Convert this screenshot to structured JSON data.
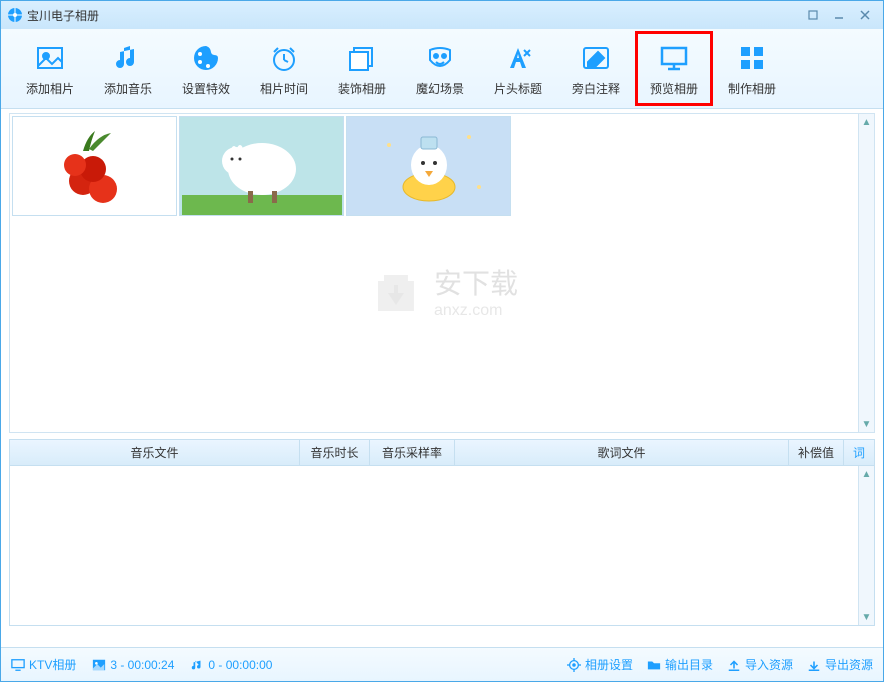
{
  "title": "宝川电子相册",
  "toolbar": [
    {
      "label": "添加相片",
      "icon": "image-icon"
    },
    {
      "label": "添加音乐",
      "icon": "music-icon"
    },
    {
      "label": "设置特效",
      "icon": "palette-icon"
    },
    {
      "label": "相片时间",
      "icon": "clock-icon"
    },
    {
      "label": "装饰相册",
      "icon": "decorate-icon"
    },
    {
      "label": "魔幻场景",
      "icon": "mask-icon"
    },
    {
      "label": "片头标题",
      "icon": "title-icon"
    },
    {
      "label": "旁白注释",
      "icon": "note-icon"
    },
    {
      "label": "预览相册",
      "icon": "monitor-icon",
      "highlighted": true
    },
    {
      "label": "制作相册",
      "icon": "grid-icon"
    }
  ],
  "thumbnails": [
    {
      "name": "thumbnail-1",
      "desc": "red lychee fruits"
    },
    {
      "name": "thumbnail-2",
      "desc": "cartoon sheep"
    },
    {
      "name": "thumbnail-3",
      "desc": "cartoon bird with float"
    }
  ],
  "watermark": {
    "main": "安下载",
    "sub": "anxz.com"
  },
  "music_table": {
    "headers": {
      "file": "音乐文件",
      "duration": "音乐时长",
      "samplerate": "音乐采样率",
      "lyric": "歌词文件",
      "compensate": "补偿值",
      "word": "词"
    },
    "rows": []
  },
  "statusbar": {
    "album_type": "KTV相册",
    "photo_count": "3 - 00:00:24",
    "music_count": "0 - 00:00:00",
    "settings": "相册设置",
    "output_dir": "输出目录",
    "import": "导入资源",
    "export": "导出资源"
  }
}
